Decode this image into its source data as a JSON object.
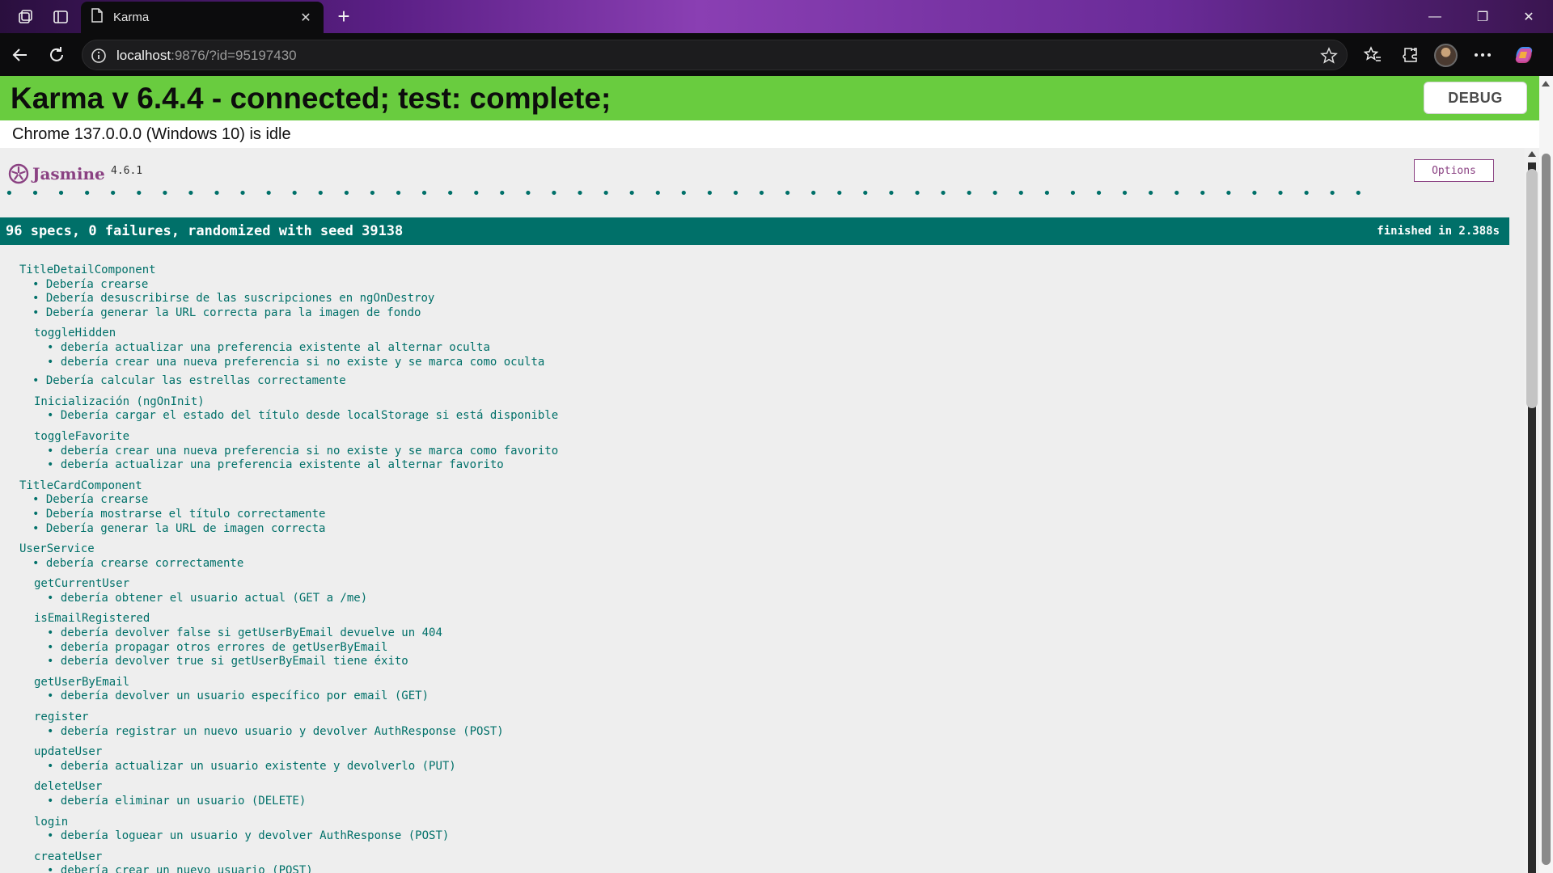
{
  "browser": {
    "tab_title": "Karma",
    "new_tab_symbol": "+",
    "address_host": "localhost",
    "address_rest": ":9876/?id=95197430",
    "window_controls": {
      "minimize": "—",
      "maximize": "❐",
      "close": "✕"
    },
    "icons": [
      "workspaces-icon",
      "tab-actions-icon",
      "page-icon",
      "close-icon",
      "back-icon",
      "refresh-icon",
      "info-icon",
      "favorite-star-icon",
      "favorites-icon",
      "extensions-icon",
      "profile-avatar",
      "more-icon",
      "copilot-icon"
    ]
  },
  "karma": {
    "title": "Karma v 6.4.4 - connected; test: complete;",
    "debug_label": "DEBUG",
    "browser_status": "Chrome 137.0.0.0 (Windows 10) is idle",
    "banner_color": "#69cc3f"
  },
  "jasmine": {
    "logo_text": "Jasmine",
    "version": "4.6.1",
    "options_label": "Options",
    "dots": "• • • • • • • • • • • • • • • • • • • • • • • • • • • • • • • • • • • • • • • • • • • • • • • • • • • • • • • • • • • • • • • • • • • • • • • • • • • • • • • • • • • • • • • • • • • • • • • • • • • • • • • • • • • •",
    "summary": "96 specs, 0 failures, randomized with seed 39138",
    "finished": "finished in 2.388s",
    "accent_color": "#007069",
    "results": [
      {
        "name": "TitleDetailComponent",
        "specs": [
          "Debería crearse",
          "Debería desuscribirse de las suscripciones en ngOnDestroy",
          "Debería generar la URL correcta para la imagen de fondo"
        ],
        "suites": [
          {
            "name": "toggleHidden",
            "specs": [
              "debería actualizar una preferencia existente al alternar oculta",
              "debería crear una nueva preferencia si no existe y se marca como oculta"
            ]
          }
        ],
        "specs_after": [
          "Debería calcular las estrellas correctamente"
        ],
        "suites_after": [
          {
            "name": "Inicialización (ngOnInit)",
            "specs": [
              "Debería cargar el estado del título desde localStorage si está disponible"
            ]
          },
          {
            "name": "toggleFavorite",
            "specs": [
              "debería crear una nueva preferencia si no existe y se marca como favorito",
              "debería actualizar una preferencia existente al alternar favorito"
            ]
          }
        ]
      },
      {
        "name": "TitleCardComponent",
        "specs": [
          "Debería crearse",
          "Debería mostrarse el título correctamente",
          "Debería generar la URL de imagen correcta"
        ]
      },
      {
        "name": "UserService",
        "specs": [
          "debería crearse correctamente"
        ],
        "suites": [
          {
            "name": "getCurrentUser",
            "specs": [
              "debería obtener el usuario actual (GET a /me)"
            ]
          },
          {
            "name": "isEmailRegistered",
            "specs": [
              "debería devolver false si getUserByEmail devuelve un 404",
              "debería propagar otros errores de getUserByEmail",
              "debería devolver true si getUserByEmail tiene éxito"
            ]
          },
          {
            "name": "getUserByEmail",
            "specs": [
              "debería devolver un usuario específico por email (GET)"
            ]
          },
          {
            "name": "register",
            "specs": [
              "debería registrar un nuevo usuario y devolver AuthResponse (POST)"
            ]
          },
          {
            "name": "updateUser",
            "specs": [
              "debería actualizar un usuario existente y devolverlo (PUT)"
            ]
          },
          {
            "name": "deleteUser",
            "specs": [
              "debería eliminar un usuario (DELETE)"
            ]
          },
          {
            "name": "login",
            "specs": [
              "debería loguear un usuario y devolver AuthResponse (POST)"
            ]
          },
          {
            "name": "createUser",
            "specs": [
              "debería crear un nuevo usuario (POST)"
            ]
          }
        ]
      }
    ]
  }
}
